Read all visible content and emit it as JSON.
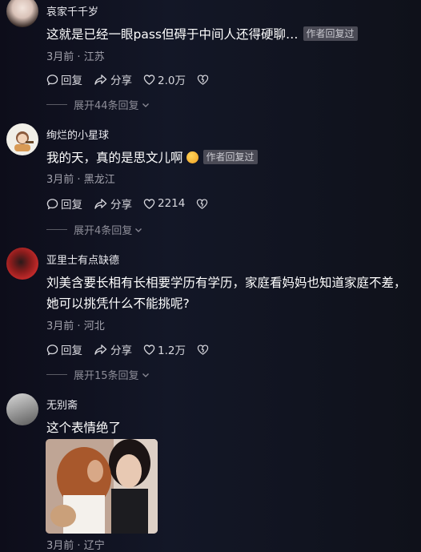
{
  "comments": [
    {
      "username": "哀家千千岁",
      "text": "这就是已经一眼pass但碍于中间人还得硬聊…",
      "author_tag": "作者回复过",
      "time": "3月前",
      "location": "江苏",
      "reply_label": "回复",
      "share_label": "分享",
      "likes": "2.0万",
      "expand": "展开44条回复"
    },
    {
      "username": "绚烂的小星球",
      "text": "我的天，真的是思文儿啊",
      "author_tag": "作者回复过",
      "time": "3月前",
      "location": "黑龙江",
      "reply_label": "回复",
      "share_label": "分享",
      "likes": "2214",
      "expand": "展开4条回复"
    },
    {
      "username": "亚里士有点缺德",
      "text": "刘美含要长相有长相要学历有学历，家庭看妈妈也知道家庭不差，她可以挑凭什么不能挑呢?",
      "time": "3月前",
      "location": "河北",
      "reply_label": "回复",
      "share_label": "分享",
      "likes": "1.2万",
      "expand": "展开15条回复"
    },
    {
      "username": "无别斋",
      "text": "这个表情绝了",
      "time": "3月前",
      "location": "辽宁"
    }
  ],
  "meta_separator": "·",
  "icons": [
    "reply-icon",
    "share-icon",
    "like-icon",
    "dislike-icon",
    "chevron-down-icon"
  ]
}
